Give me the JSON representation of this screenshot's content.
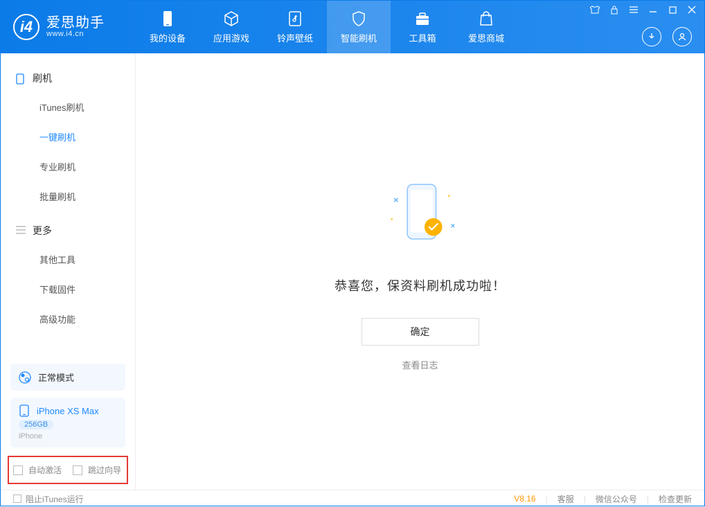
{
  "app": {
    "name": "爱思助手",
    "url": "www.i4.cn"
  },
  "tabs": [
    {
      "label": "我的设备"
    },
    {
      "label": "应用游戏"
    },
    {
      "label": "铃声壁纸"
    },
    {
      "label": "智能刷机"
    },
    {
      "label": "工具箱"
    },
    {
      "label": "爱思商城"
    }
  ],
  "activeTabIndex": 3,
  "sidebar": {
    "section1": {
      "title": "刷机",
      "items": [
        {
          "label": "iTunes刷机"
        },
        {
          "label": "一键刷机"
        },
        {
          "label": "专业刷机"
        },
        {
          "label": "批量刷机"
        }
      ],
      "activeIndex": 1
    },
    "section2": {
      "title": "更多",
      "items": [
        {
          "label": "其他工具"
        },
        {
          "label": "下载固件"
        },
        {
          "label": "高级功能"
        }
      ]
    },
    "mode": {
      "label": "正常模式"
    },
    "device": {
      "name": "iPhone XS Max",
      "storage": "256GB",
      "type": "iPhone"
    },
    "options": {
      "autoActivate": "自动激活",
      "skipGuide": "跳过向导"
    }
  },
  "main": {
    "successMessage": "恭喜您，保资料刷机成功啦！",
    "confirmLabel": "确定",
    "logLink": "查看日志"
  },
  "footer": {
    "blockItunes": "阻止iTunes运行",
    "version": "V8.16",
    "links": {
      "support": "客服",
      "wechat": "微信公众号",
      "checkUpdate": "检查更新"
    }
  }
}
